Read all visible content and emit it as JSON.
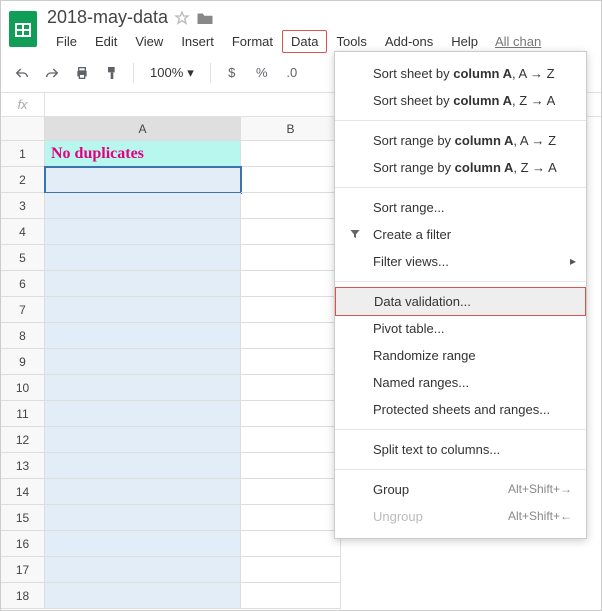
{
  "doc": {
    "title": "2018-may-data"
  },
  "menu": {
    "file": "File",
    "edit": "Edit",
    "view": "View",
    "insert": "Insert",
    "format": "Format",
    "data": "Data",
    "tools": "Tools",
    "addons": "Add-ons",
    "help": "Help",
    "last_change": "All chan"
  },
  "toolbar": {
    "zoom": "100%",
    "currency": "$",
    "percent": "%",
    "decimal": ".0"
  },
  "fx": "fx",
  "columns": {
    "a": "A",
    "b": "B"
  },
  "rows": [
    "1",
    "2",
    "3",
    "4",
    "5",
    "6",
    "7",
    "8",
    "9",
    "10",
    "11",
    "12",
    "13",
    "14",
    "15",
    "16",
    "17",
    "18"
  ],
  "cells": {
    "a1": "No duplicates"
  },
  "dropdown": {
    "sort_sheet_az_pre": "Sort sheet by ",
    "sort_sheet_az_col": "column A",
    "sort_sheet_az_suf": ", A → Z",
    "sort_sheet_za_pre": "Sort sheet by ",
    "sort_sheet_za_col": "column A",
    "sort_sheet_za_suf": ", Z → A",
    "sort_range_az_pre": "Sort range by ",
    "sort_range_az_col": "column A",
    "sort_range_az_suf": ", A → Z",
    "sort_range_za_pre": "Sort range by ",
    "sort_range_za_col": "column A",
    "sort_range_za_suf": ", Z → A",
    "sort_range": "Sort range...",
    "create_filter": "Create a filter",
    "filter_views": "Filter views...",
    "data_validation": "Data validation...",
    "pivot_table": "Pivot table...",
    "randomize": "Randomize range",
    "named_ranges": "Named ranges...",
    "protected": "Protected sheets and ranges...",
    "split_text": "Split text to columns...",
    "group": "Group",
    "group_sc": "Alt+Shift+→",
    "ungroup": "Ungroup",
    "ungroup_sc": "Alt+Shift+←"
  }
}
